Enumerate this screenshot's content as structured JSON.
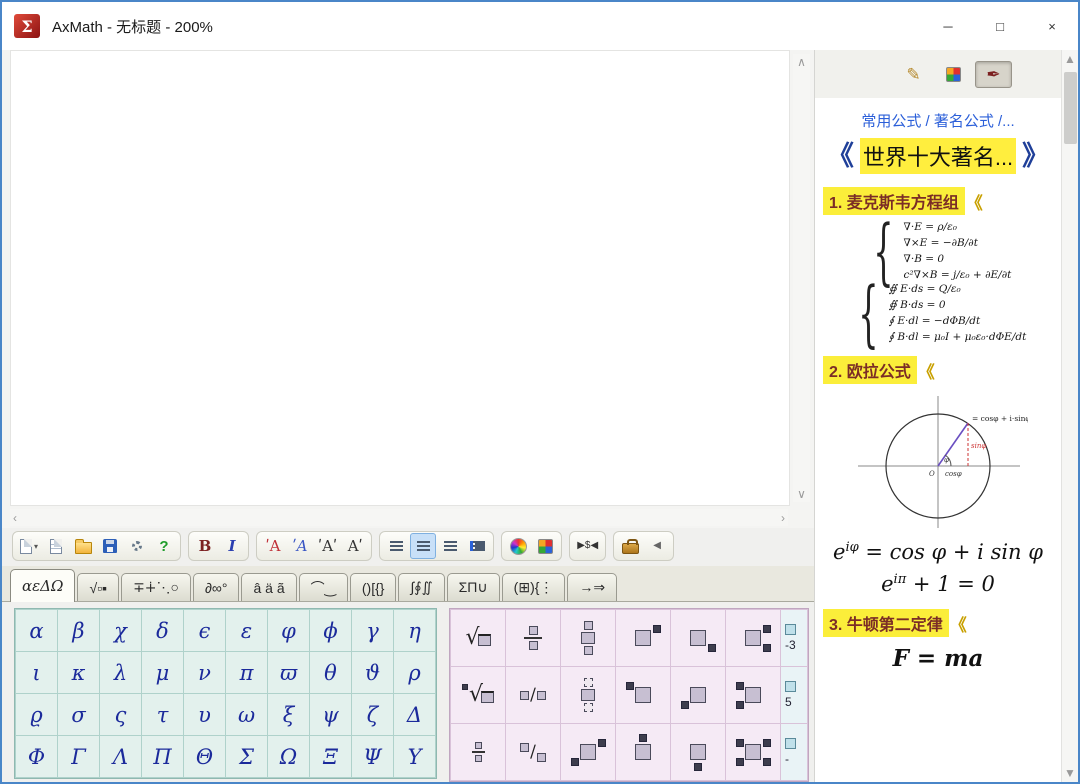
{
  "window": {
    "title": "AxMath - 无标题 - 200%",
    "logo_glyph": "Σ",
    "controls": {
      "minimize": "─",
      "maximize": "□",
      "close": "×"
    }
  },
  "canvas": {
    "vscroll_up": "∧",
    "vscroll_down": "∨",
    "hscroll_left": "‹",
    "hscroll_right": "›"
  },
  "toolbar": {
    "groups": [
      [
        {
          "name": "new-from-template-button",
          "kind": "page",
          "extra": "▾"
        },
        {
          "name": "new-document-button",
          "kind": "page2"
        },
        {
          "name": "open-button",
          "kind": "folder"
        },
        {
          "name": "save-button",
          "kind": "save"
        },
        {
          "name": "settings-button",
          "kind": "gear"
        },
        {
          "name": "help-button",
          "kind": "glyph",
          "glyph": "?",
          "color": "#1f9d2a",
          "bold": true
        }
      ],
      [
        {
          "name": "bold-button",
          "kind": "glyph",
          "glyph": "B",
          "color": "#7b2020",
          "serif": true,
          "bold": true
        },
        {
          "name": "italic-button",
          "kind": "glyph",
          "glyph": "I",
          "color": "#2b3fb0",
          "serif": true,
          "italic": true,
          "bold": true
        }
      ],
      [
        {
          "name": "font-style-red-button",
          "kind": "glyph",
          "glyph": "ʹA",
          "color": "#c03038",
          "serif": true
        },
        {
          "name": "font-style-blue-button",
          "kind": "glyph",
          "glyph": "ʹA",
          "color": "#3a56c4",
          "serif": true,
          "italic": true
        },
        {
          "name": "font-accent-both-button",
          "kind": "glyph",
          "glyph": "ʹAʹ",
          "color": "#333333",
          "serif": true
        },
        {
          "name": "font-accent-right-button",
          "kind": "glyph",
          "glyph": "Aʹ",
          "color": "#333333",
          "serif": true
        }
      ],
      [
        {
          "name": "align-left-button",
          "kind": "bars"
        },
        {
          "name": "align-center-button",
          "kind": "bars",
          "active": true
        },
        {
          "name": "align-right-button",
          "kind": "bars"
        },
        {
          "name": "line-numbering-button",
          "kind": "bars-dots"
        }
      ],
      [
        {
          "name": "color-wheel-button",
          "kind": "wheel"
        },
        {
          "name": "color-palette-button",
          "kind": "quad"
        }
      ],
      [
        {
          "name": "fit-width-button",
          "kind": "glyph",
          "glyph": "▶$◀",
          "color": "#333333",
          "small": true
        }
      ],
      [
        {
          "name": "toolbox-button",
          "kind": "brief"
        },
        {
          "name": "collapse-button",
          "kind": "glyph",
          "glyph": "◀",
          "color": "#666666",
          "small": true
        }
      ]
    ]
  },
  "tabs": [
    {
      "name": "tab-greek",
      "label": "αεΔΩ",
      "active": true,
      "serif": true
    },
    {
      "name": "tab-fractions-roots",
      "label": "√▫▪"
    },
    {
      "name": "tab-operators",
      "label": "∓∔⋱○"
    },
    {
      "name": "tab-misc-symbols",
      "label": "∂∞°"
    },
    {
      "name": "tab-accents",
      "label": "â ä ã"
    },
    {
      "name": "tab-decorations",
      "label": "⌒‿"
    },
    {
      "name": "tab-brackets",
      "label": "()[{}"
    },
    {
      "name": "tab-integrals",
      "label": "∫∮∬"
    },
    {
      "name": "tab-big-operators",
      "label": "ΣΠ∪"
    },
    {
      "name": "tab-matrices",
      "label": "(⊞){⋮"
    },
    {
      "name": "tab-arrows",
      "label": "→⇒"
    }
  ],
  "greek": [
    "α",
    "β",
    "χ",
    "δ",
    "ϵ",
    "ε",
    "φ",
    "ϕ",
    "γ",
    "η",
    "ι",
    "κ",
    "λ",
    "μ",
    "ν",
    "π",
    "ϖ",
    "θ",
    "ϑ",
    "ρ",
    "ϱ",
    "σ",
    "ς",
    "τ",
    "υ",
    "ω",
    "ξ",
    "ψ",
    "ζ",
    "Δ",
    "Φ",
    "Γ",
    "Λ",
    "Π",
    "Θ",
    "Σ",
    "Ω",
    "Ξ",
    "Ψ",
    "Υ"
  ],
  "templates": {
    "cells": [
      {
        "name": "template-sqrt",
        "kind": "sqrt"
      },
      {
        "name": "template-fraction",
        "kind": "frac"
      },
      {
        "name": "template-over-under",
        "kind": "overunder"
      },
      {
        "name": "template-superscript",
        "kind": "marks",
        "marks": [
          "tr"
        ]
      },
      {
        "name": "template-subscript",
        "kind": "marks",
        "marks": [
          "br"
        ]
      },
      {
        "name": "template-sub-superscript",
        "kind": "marks",
        "marks": [
          "tr",
          "br"
        ]
      },
      {
        "name": "template-nth-root",
        "kind": "nroot"
      },
      {
        "name": "template-inline-division",
        "kind": "slash"
      },
      {
        "name": "template-stack",
        "kind": "stack"
      },
      {
        "name": "template-pre-superscript",
        "kind": "marks",
        "marks": [
          "tl"
        ]
      },
      {
        "name": "template-pre-subscript",
        "kind": "marks",
        "marks": [
          "bl"
        ]
      },
      {
        "name": "template-pre-scripts",
        "kind": "marks",
        "marks": [
          "tl",
          "bl"
        ]
      },
      {
        "name": "template-small-fraction",
        "kind": "sfrac"
      },
      {
        "name": "template-slanted-fraction",
        "kind": "dfrac"
      },
      {
        "name": "template-mixed-scripts",
        "kind": "marks",
        "marks": [
          "tr",
          "bl"
        ]
      },
      {
        "name": "template-overscript",
        "kind": "marks",
        "marks": [
          "over"
        ]
      },
      {
        "name": "template-underscript",
        "kind": "marks",
        "marks": [
          "under"
        ]
      },
      {
        "name": "template-all-scripts",
        "kind": "marks",
        "marks": [
          "tl",
          "tr",
          "bl",
          "br"
        ]
      }
    ],
    "partial_labels": [
      "-3",
      "5",
      "-"
    ]
  },
  "panel": {
    "tools": [
      {
        "name": "handwriting-button",
        "glyph": "✎",
        "color": "#b68a2e"
      },
      {
        "name": "color-grid-button",
        "kind": "quad"
      },
      {
        "name": "formula-library-button",
        "glyph": "✒",
        "color": "#7b1f1f",
        "active": true
      }
    ],
    "scroll_up": "▲",
    "scroll_down": "▼",
    "breadcrumb": "常用公式 / 著名公式 /...",
    "nav": {
      "prev": "《",
      "title": "世界十大著名...",
      "next": "》"
    },
    "sections": [
      {
        "label": "1. 麦克斯韦方程组",
        "suffix": "《"
      },
      {
        "label": "2. 欧拉公式",
        "suffix": "《"
      },
      {
        "label": "3. 牛顿第二定律",
        "suffix": "《"
      }
    ],
    "maxwell": {
      "differential": [
        "∇·E = ρ/ε₀",
        "∇×E = −∂B/∂t",
        "∇·B = 0",
        "c²∇×B = j/ε₀ + ∂E/∂t"
      ],
      "integral": [
        "∯ E·ds = Q/ε₀",
        "∯ B·ds = 0",
        "∮ E·dl = −dΦB/dt",
        "∮ B·dl = μ₀I + μ₀ε₀·dΦE/dt"
      ]
    },
    "euler": {
      "note": "= cosφ + i·sinφ",
      "angle": "φ",
      "sin": "sinφ",
      "cos": "cosφ",
      "origin": "O",
      "formula1": {
        "base": "e",
        "sup": "iφ",
        "rest": " = cos φ + i sin φ"
      },
      "formula2": {
        "base": "e",
        "sup": "iπ",
        "rest": " + 1 = 0"
      }
    },
    "newton": {
      "formula": "F = ma"
    }
  }
}
